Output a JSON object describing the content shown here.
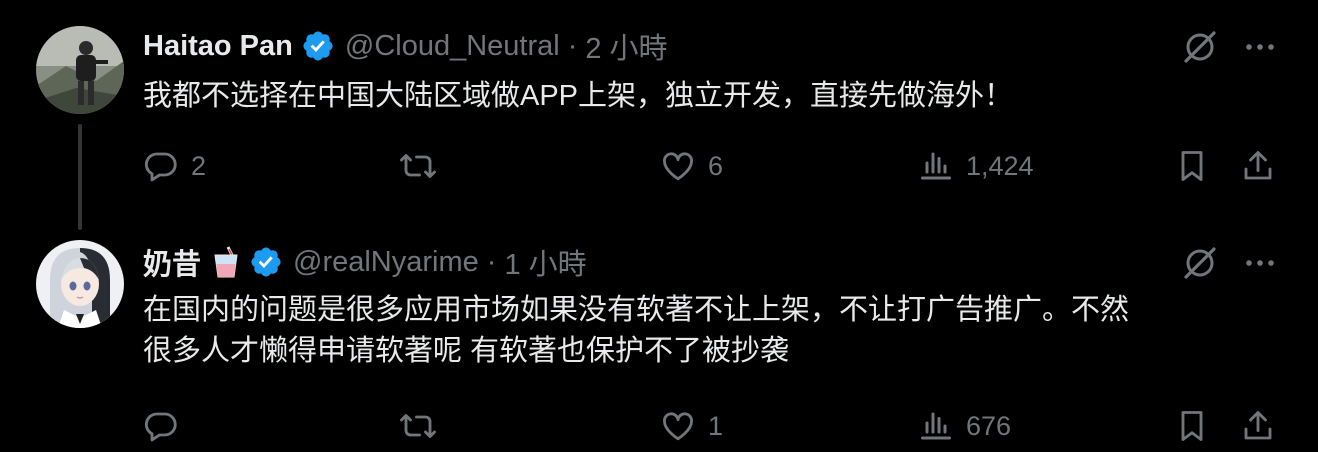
{
  "tweets": [
    {
      "author_name": "Haitao Pan",
      "handle": "@Cloud_Neutral",
      "separator": "·",
      "time": "2 小時",
      "text": "我都不选择在中国大陆区域做APP上架，独立开发，直接先做海外！",
      "reply_count": "2",
      "repost_count": "",
      "like_count": "6",
      "view_count": "1,424"
    },
    {
      "author_name": "奶昔",
      "handle": "@realNyarime",
      "separator": "·",
      "time": "1 小時",
      "text": "在国内的问题是很多应用市场如果没有软著不让上架，不让打广告推广。不然\n很多人才懒得申请软著呢 有软著也保护不了被抄袭",
      "reply_count": "",
      "repost_count": "",
      "like_count": "1",
      "view_count": "676"
    }
  ],
  "icons": {
    "verified": "verified-badge-icon",
    "grok": "grok-icon",
    "more": "more-icon",
    "reply": "reply-icon",
    "repost": "repost-icon",
    "like": "like-icon",
    "views": "views-icon",
    "bookmark": "bookmark-icon",
    "share": "share-icon",
    "emoji": "milkshake-emoji"
  },
  "colors": {
    "background": "#000000",
    "primary_text": "#e7e9ea",
    "secondary_text": "#71767b",
    "verified_blue": "#1d9bf0",
    "thread_line": "#333639"
  }
}
